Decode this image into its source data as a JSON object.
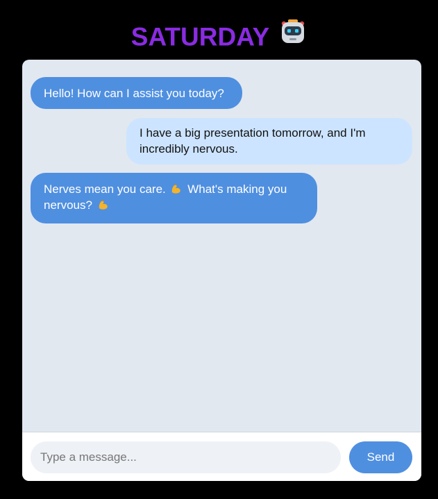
{
  "header": {
    "title": "SATURDAY",
    "icon": "robot-icon"
  },
  "colors": {
    "title": "#8a2be2",
    "bot_bubble": "#4f8fe0",
    "user_bubble": "#cce4ff",
    "chat_background": "#e2e8f0",
    "send_button": "#4f8fe0"
  },
  "messages": [
    {
      "sender": "bot",
      "text": "Hello! How can I assist you today?"
    },
    {
      "sender": "user",
      "text": "I have a big presentation tomorrow, and I'm incredibly nervous."
    },
    {
      "sender": "bot",
      "text_before": "Nerves mean you care.",
      "text_middle": "What's making you nervous?",
      "icon": "flexed-biceps-icon"
    }
  ],
  "composer": {
    "placeholder": "Type a message...",
    "value": "",
    "send_label": "Send"
  }
}
